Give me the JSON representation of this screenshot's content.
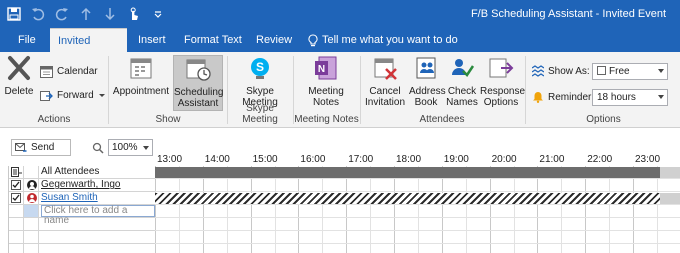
{
  "window": {
    "title": "F/B Scheduling Assistant - Invited Event"
  },
  "tabs": {
    "file": "File",
    "invited_event": "Invited Event",
    "insert": "Insert",
    "format_text": "Format Text",
    "review": "Review",
    "tell_me": "Tell me what you want to do"
  },
  "ribbon": {
    "actions": {
      "delete": "Delete",
      "calendar": "Calendar",
      "forward": "Forward",
      "label": "Actions"
    },
    "show": {
      "appointment": "Appointment",
      "scheduling_line1": "Scheduling",
      "scheduling_line2": "Assistant",
      "label": "Show"
    },
    "skype": {
      "line1": "Skype",
      "line2": "Meeting",
      "label": "Skype Meeting"
    },
    "meeting_notes": {
      "line1": "Meeting",
      "line2": "Notes",
      "label": "Meeting Notes"
    },
    "attendees": {
      "cancel_line1": "Cancel",
      "cancel_line2": "Invitation",
      "address_line1": "Address",
      "address_line2": "Book",
      "check_line1": "Check",
      "check_line2": "Names",
      "response_line1": "Response",
      "response_line2": "Options",
      "label": "Attendees"
    },
    "options": {
      "show_as_label": "Show As:",
      "show_as_value": "Free",
      "reminder_label": "Reminder:",
      "reminder_value": "18 hours",
      "label": "Options"
    }
  },
  "scheduling": {
    "send_label": "Send",
    "zoom_value": "100%",
    "hours": [
      "13:00",
      "14:00",
      "15:00",
      "16:00",
      "17:00",
      "18:00",
      "19:00",
      "20:00",
      "21:00",
      "22:00",
      "23:00"
    ],
    "all_attendees": "All Attendees",
    "attendees": [
      {
        "name": "Gegenwarth, Ingo",
        "role": "organizer"
      },
      {
        "name": "Susan Smith",
        "role": "required"
      }
    ],
    "add_placeholder": "Click here to add a name"
  },
  "colors": {
    "titlebar": "#1f64b8",
    "ribbon_bg": "#f3f3f3",
    "busy": "#6d6d6d"
  },
  "icons": [
    "save-icon",
    "undo-icon",
    "redo-icon",
    "up-arrow-icon",
    "down-arrow-icon",
    "touch-mode-icon",
    "customize-qat-icon",
    "lightbulb-icon",
    "delete-icon",
    "calendar-icon",
    "forward-icon",
    "appointment-icon",
    "scheduling-assistant-icon",
    "skype-icon",
    "onenote-icon",
    "cancel-invitation-icon",
    "address-book-icon",
    "check-names-icon",
    "response-options-icon",
    "show-as-icon",
    "reminder-bell-icon",
    "send-icon",
    "zoom-icon"
  ]
}
